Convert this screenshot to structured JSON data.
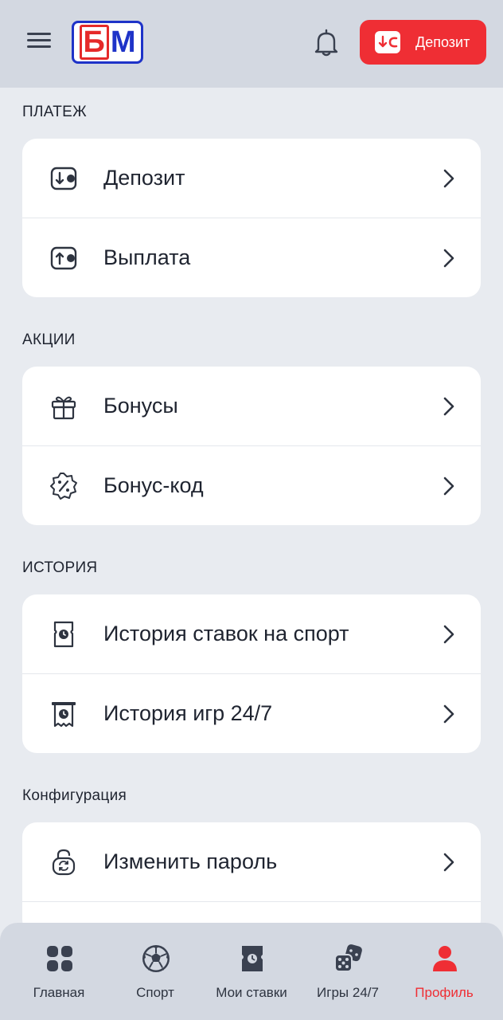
{
  "header": {
    "logo_letters": [
      "Б",
      "М"
    ],
    "deposit_button_label": "Депозит",
    "menu_icon": "hamburger-menu-icon",
    "bell_icon": "bell-icon"
  },
  "sections": [
    {
      "title": "ПЛАТЕЖ",
      "items": [
        {
          "label": "Депозит",
          "icon": "deposit-icon"
        },
        {
          "label": "Выплата",
          "icon": "withdrawal-icon"
        }
      ]
    },
    {
      "title": "АКЦИИ",
      "items": [
        {
          "label": "Бонусы",
          "icon": "gift-icon"
        },
        {
          "label": "Бонус-код",
          "icon": "percent-badge-icon"
        }
      ]
    },
    {
      "title": "ИСТОРИЯ",
      "items": [
        {
          "label": "История ставок на спорт",
          "icon": "bet-ticket-clock-icon"
        },
        {
          "label": "История игр 24/7",
          "icon": "receipt-clock-icon"
        }
      ]
    },
    {
      "title": "Конфигурация",
      "items": [
        {
          "label": "Изменить пароль",
          "icon": "lock-refresh-icon"
        }
      ]
    }
  ],
  "bottom_nav": [
    {
      "label": "Главная",
      "icon": "grid-icon",
      "active": false
    },
    {
      "label": "Спорт",
      "icon": "soccer-ball-icon",
      "active": false
    },
    {
      "label": "Мои ставки",
      "icon": "ticket-icon",
      "active": false
    },
    {
      "label": "Игры 24/7",
      "icon": "dice-icon",
      "active": false
    },
    {
      "label": "Профиль",
      "icon": "user-icon",
      "active": true
    }
  ],
  "colors": {
    "accent": "#EF2E34",
    "background": "#E8EBF0",
    "header_bg": "#D3D8E1",
    "logo_blue": "#1E33C8",
    "text": "#1F2430"
  }
}
